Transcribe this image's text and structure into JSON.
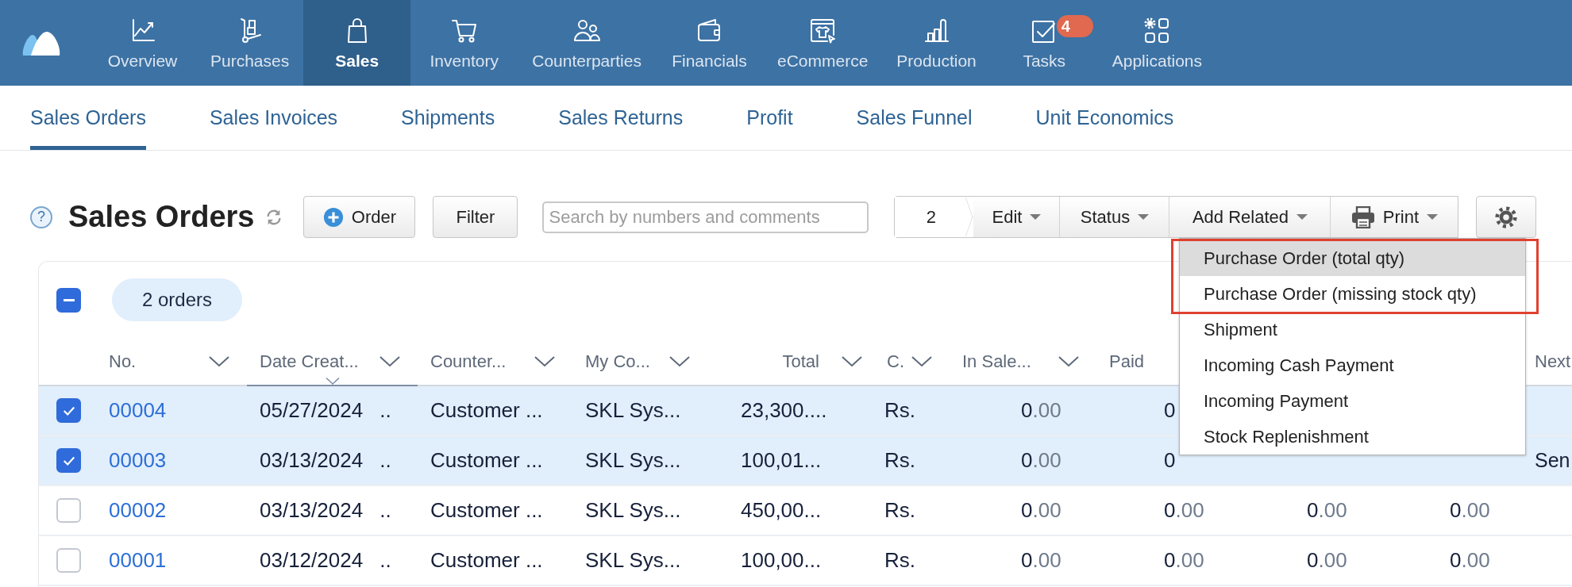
{
  "app_nav": [
    {
      "label": "Overview",
      "selected": false
    },
    {
      "label": "Purchases",
      "selected": false
    },
    {
      "label": "Sales",
      "selected": true
    },
    {
      "label": "Inventory",
      "selected": false
    },
    {
      "label": "Counterparties",
      "selected": false
    },
    {
      "label": "Financials",
      "selected": false
    },
    {
      "label": "eCommerce",
      "selected": false
    },
    {
      "label": "Production",
      "selected": false
    },
    {
      "label": "Tasks",
      "selected": false,
      "badge": "4"
    },
    {
      "label": "Applications",
      "selected": false
    }
  ],
  "sub_nav": [
    {
      "label": "Sales Orders",
      "selected": true
    },
    {
      "label": "Sales Invoices",
      "selected": false
    },
    {
      "label": "Shipments",
      "selected": false
    },
    {
      "label": "Sales Returns",
      "selected": false
    },
    {
      "label": "Profit",
      "selected": false
    },
    {
      "label": "Sales Funnel",
      "selected": false
    },
    {
      "label": "Unit Economics",
      "selected": false
    }
  ],
  "toolbar": {
    "help": "?",
    "title": "Sales Orders",
    "create_button": "Order",
    "filter_button": "Filter",
    "search": {
      "placeholder": "Search by numbers and comments"
    },
    "selection_count": "2",
    "actions": [
      {
        "label": "Edit",
        "kind": "menu"
      },
      {
        "label": "Status",
        "kind": "menu"
      },
      {
        "label": "Add Related",
        "kind": "menu"
      },
      {
        "label": "Print",
        "kind": "print"
      }
    ]
  },
  "menu": {
    "items": [
      {
        "label": "Purchase Order (total qty)",
        "selected": true,
        "highlighted": true
      },
      {
        "label": "Purchase Order (missing stock qty)",
        "selected": false,
        "highlighted": true
      },
      {
        "label": "Shipment",
        "selected": false,
        "highlighted": false
      },
      {
        "label": "Incoming Cash Payment",
        "selected": false,
        "highlighted": false
      },
      {
        "label": "Incoming Payment",
        "selected": false,
        "highlighted": false
      },
      {
        "label": "Stock Replenishment",
        "selected": false,
        "highlighted": false
      }
    ]
  },
  "table": {
    "select_all": {
      "indeterminate": true
    },
    "count_badge": "2 orders",
    "columns": [
      {
        "label": "No.",
        "dropdown": true,
        "sorted": false
      },
      {
        "label": "Date Creat...",
        "dropdown": true,
        "sorted": true
      },
      {
        "label": "Counter...",
        "dropdown": true,
        "sorted": false
      },
      {
        "label": "My Co...",
        "dropdown": true,
        "sorted": false
      },
      {
        "label": "Total",
        "dropdown": true,
        "sorted": false
      },
      {
        "label": "C.",
        "dropdown": true,
        "sorted": false
      },
      {
        "label": "In Sale...",
        "dropdown": true,
        "sorted": false
      },
      {
        "label": "Paid",
        "sorted": false
      },
      {
        "label": "Next",
        "sorted": false
      }
    ],
    "rows": [
      {
        "selected": true,
        "cells": {
          "no": "00004",
          "date": "05/27/2024 ..",
          "counterparty": "Customer ...",
          "my_company": "SKL Sys...",
          "total": "23,300....",
          "currency": "Rs.",
          "in_sales": "0.00",
          "paid": "0"
        }
      },
      {
        "selected": true,
        "cells": {
          "no": "00003",
          "date": "03/13/2024 ..",
          "counterparty": "Customer ...",
          "my_company": "SKL Sys...",
          "total": "100,01...",
          "currency": "Rs.",
          "in_sales": "0.00",
          "paid": "0",
          "next": "Sen"
        }
      },
      {
        "selected": false,
        "cells": {
          "no": "00002",
          "date": "03/13/2024 ..",
          "counterparty": "Customer ...",
          "my_company": "SKL Sys...",
          "total": "450,00...",
          "currency": "Rs.",
          "in_sales": "0.00",
          "paid": "0.00",
          "column_9": "0.00",
          "column_10": "0.00"
        }
      },
      {
        "selected": false,
        "cells": {
          "no": "00001",
          "date": "03/12/2024 ..",
          "counterparty": "Customer ...",
          "my_company": "SKL Sys...",
          "total": "100,00...",
          "currency": "Rs.",
          "in_sales": "0.00",
          "paid": "0.00",
          "column_9": "0.00",
          "column_10": "0.00"
        }
      }
    ]
  }
}
